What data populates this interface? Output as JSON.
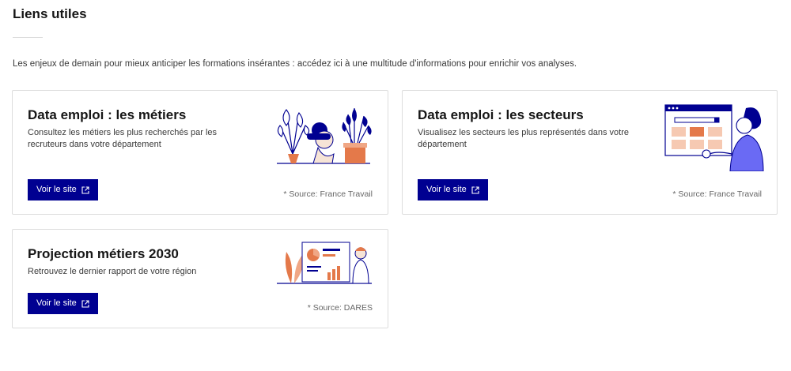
{
  "page": {
    "title": "Liens utiles",
    "intro": "Les enjeux de demain pour mieux anticiper les formations insérantes : accédez ici à une multitude d'informations pour enrichir vos analyses."
  },
  "cards": [
    {
      "title": "Data emploi : les métiers",
      "description": "Consultez les métiers les plus recherchés par les recruteurs dans votre département",
      "button_label": "Voir le site",
      "button_icon": "external-link-icon",
      "source": "* Source: France Travail",
      "illustration": "plants-person-illustration"
    },
    {
      "title": "Data emploi : les secteurs",
      "description": "Visualisez les secteurs les plus représentés dans votre département",
      "button_label": "Voir le site",
      "button_icon": "external-link-icon",
      "source": "* Source: France Travail",
      "illustration": "browser-person-illustration"
    },
    {
      "title": "Projection métiers 2030",
      "description": "Retrouvez le dernier rapport de votre région",
      "button_label": "Voir le site",
      "button_icon": "external-link-icon",
      "source": "* Source: DARES",
      "illustration": "report-chart-illustration"
    }
  ],
  "colors": {
    "primary_button": "#000091",
    "border": "#dddddd",
    "text": "#161616",
    "muted": "#666666",
    "accent_orange": "#e4794a",
    "accent_blue": "#000091"
  }
}
